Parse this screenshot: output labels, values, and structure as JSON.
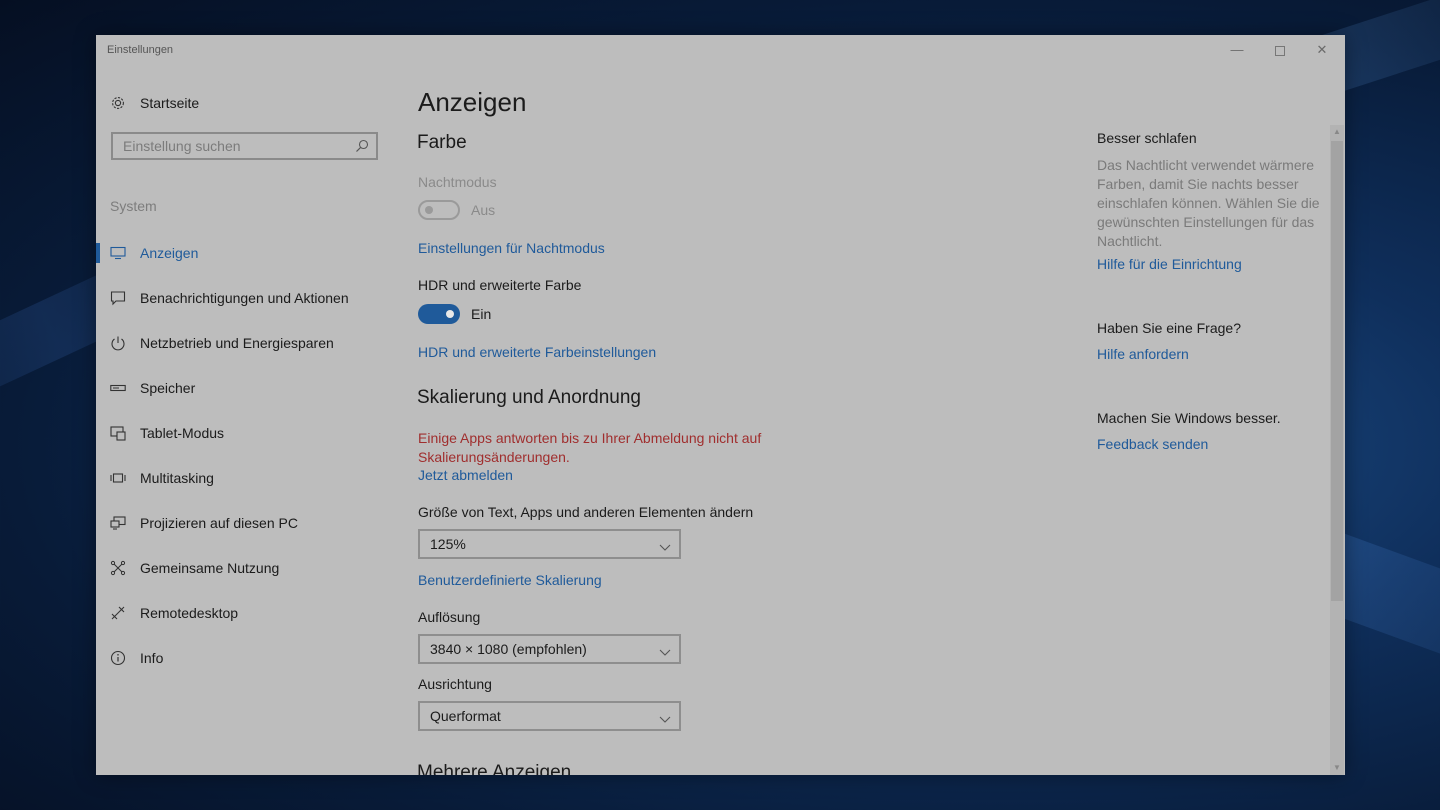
{
  "window": {
    "title": "Einstellungen",
    "controls": {
      "minimize": "—",
      "close": "✕"
    }
  },
  "sidebar": {
    "home_label": "Startseite",
    "search_placeholder": "Einstellung suchen",
    "section_label": "System",
    "items": [
      {
        "label": "Anzeigen",
        "icon": "display-icon",
        "active": true
      },
      {
        "label": "Benachrichtigungen und Aktionen",
        "icon": "notification-icon"
      },
      {
        "label": "Netzbetrieb und Energiesparen",
        "icon": "power-icon"
      },
      {
        "label": "Speicher",
        "icon": "storage-icon"
      },
      {
        "label": "Tablet-Modus",
        "icon": "tablet-mode-icon"
      },
      {
        "label": "Multitasking",
        "icon": "multitasking-icon"
      },
      {
        "label": "Projizieren auf diesen PC",
        "icon": "project-icon"
      },
      {
        "label": "Gemeinsame Nutzung",
        "icon": "share-icon"
      },
      {
        "label": "Remotedesktop",
        "icon": "remote-desktop-icon"
      },
      {
        "label": "Info",
        "icon": "info-icon"
      }
    ]
  },
  "main": {
    "title": "Anzeigen",
    "color_section": {
      "heading": "Farbe",
      "night_mode_label": "Nachtmodus",
      "night_mode_state": "Aus",
      "night_mode_settings_link": "Einstellungen für Nachtmodus",
      "hdr_label": "HDR und erweiterte Farbe",
      "hdr_state": "Ein",
      "hdr_settings_link": "HDR und erweiterte Farbeinstellungen"
    },
    "scaling_section": {
      "heading": "Skalierung und Anordnung",
      "warning": "Einige Apps antworten bis zu Ihrer Abmeldung nicht auf Skalierungsänderungen.",
      "signout_link": "Jetzt abmelden",
      "size_label": "Größe von Text, Apps und anderen Elementen ändern",
      "size_value": "125%",
      "custom_scaling_link": "Benutzerdefinierte Skalierung",
      "resolution_label": "Auflösung",
      "resolution_value": "3840 × 1080 (empfohlen)",
      "orientation_label": "Ausrichtung",
      "orientation_value": "Querformat"
    },
    "multiple_displays_heading": "Mehrere Anzeigen"
  },
  "aside": {
    "sleep_heading": "Besser schlafen",
    "sleep_text": "Das Nachtlicht verwendet wärmere Farben, damit Sie nachts besser einschlafen können. Wählen Sie die gewünschten Einstellungen für das Nachtlicht.",
    "sleep_link": "Hilfe für die Einrichtung",
    "question_heading": "Haben Sie eine Frage?",
    "question_link": "Hilfe anfordern",
    "feedback_heading": "Machen Sie Windows besser.",
    "feedback_link": "Feedback senden"
  }
}
